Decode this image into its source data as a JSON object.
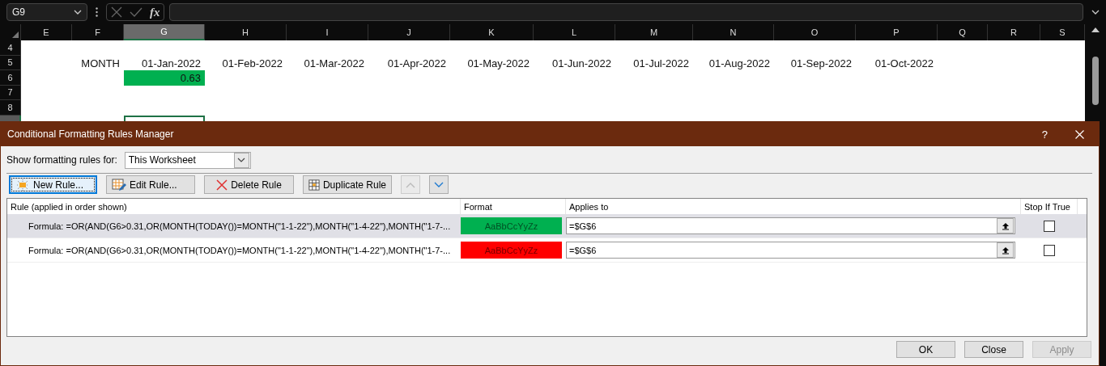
{
  "name_box": {
    "value": "G9"
  },
  "formula_bar": {
    "function_label": "fx"
  },
  "sheet": {
    "columns": [
      {
        "label": "E",
        "selected": false
      },
      {
        "label": "F",
        "selected": false
      },
      {
        "label": "G",
        "selected": true
      },
      {
        "label": "H",
        "selected": false
      },
      {
        "label": "I",
        "selected": false
      },
      {
        "label": "J",
        "selected": false
      },
      {
        "label": "K",
        "selected": false
      },
      {
        "label": "L",
        "selected": false
      },
      {
        "label": "M",
        "selected": false
      },
      {
        "label": "N",
        "selected": false
      },
      {
        "label": "O",
        "selected": false
      },
      {
        "label": "P",
        "selected": false
      },
      {
        "label": "Q",
        "selected": false
      },
      {
        "label": "R",
        "selected": false
      },
      {
        "label": "S",
        "selected": false
      }
    ],
    "rows": [
      {
        "label": "4",
        "cells": []
      },
      {
        "label": "5",
        "cells": [
          null,
          {
            "value": "MONTH",
            "selected": false
          },
          {
            "value": "01-Jan-2022",
            "selected": false
          },
          {
            "value": "01-Feb-2022",
            "selected": false
          },
          {
            "value": "01-Mar-2022",
            "selected": false
          },
          {
            "value": "01-Apr-2022",
            "selected": false
          },
          {
            "value": "01-May-2022",
            "selected": false
          },
          {
            "value": "01-Jun-2022",
            "selected": false
          },
          {
            "value": "01-Jul-2022",
            "selected": false
          },
          {
            "value": "01-Aug-2022",
            "selected": false
          },
          {
            "value": "01-Sep-2022",
            "selected": false
          },
          {
            "value": "01-Oct-2022",
            "selected": false
          }
        ]
      },
      {
        "label": "6",
        "cells": [
          null,
          null,
          {
            "value": "0.63",
            "color": "#00b050",
            "selected": false
          }
        ]
      },
      {
        "label": "7",
        "cells": []
      },
      {
        "label": "8",
        "cells": []
      },
      {
        "cells": [
          null,
          null,
          {
            "selected": true
          }
        ]
      }
    ]
  },
  "dialog": {
    "title": "Conditional Formatting Rules Manager",
    "help": "?",
    "show_label": "Show formatting rules for:",
    "show_value": "This Worksheet",
    "toolbar": [
      {
        "kind": "new",
        "label": "New Rule...",
        "focused": true,
        "disabled": false
      },
      {
        "kind": "edit",
        "label": "Edit Rule...",
        "focused": false,
        "disabled": false
      },
      {
        "kind": "delete",
        "label": "Delete Rule",
        "focused": false,
        "disabled": false
      },
      {
        "kind": "duplicate",
        "label": "Duplicate Rule",
        "focused": false,
        "disabled": false
      },
      {
        "kind": "up",
        "disabled": true
      },
      {
        "kind": "down",
        "disabled": false
      }
    ],
    "columns": [
      "Rule (applied in order shown)",
      "Format",
      "Applies to",
      "Stop If True"
    ],
    "rules": [
      {
        "rule": "Formula: =OR(AND(G6>0.31,OR(MONTH(TODAY())=MONTH(\"1-1-22\"),MONTH(\"1-4-22\"),MONTH(\"1-7-...",
        "preview": "AaBbCcYyZz",
        "color": "#00b050",
        "applies_to": "=$G$6",
        "stop_if_true": false,
        "selected": true
      },
      {
        "rule": "Formula: =OR(AND(G6>0.31,OR(MONTH(TODAY())=MONTH(\"1-1-22\"),MONTH(\"1-4-22\"),MONTH(\"1-7-...",
        "preview": "AaBbCcYyZz",
        "color": "#ff0000",
        "applies_to": "=$G$6",
        "stop_if_true": false,
        "selected": false
      }
    ],
    "buttons": [
      {
        "label": "OK",
        "disabled": false
      },
      {
        "label": "Close",
        "disabled": false
      },
      {
        "label": "Apply",
        "disabled": true
      }
    ]
  }
}
